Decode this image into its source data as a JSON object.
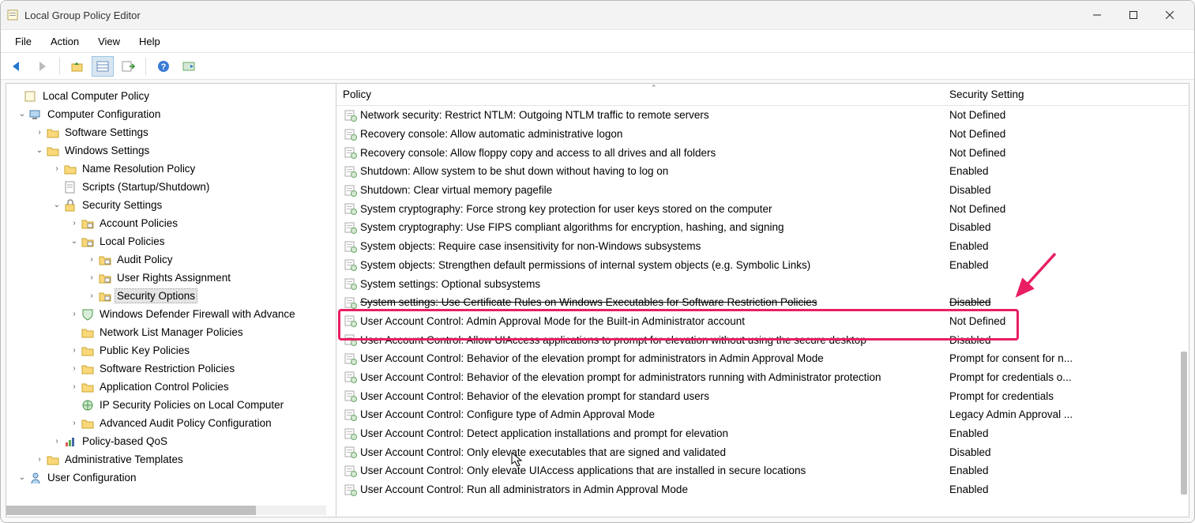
{
  "window": {
    "title": "Local Group Policy Editor"
  },
  "menubar": [
    "File",
    "Action",
    "View",
    "Help"
  ],
  "tree": {
    "root": "Local Computer Policy",
    "cc": "Computer Configuration",
    "ss": "Software Settings",
    "ws": "Windows Settings",
    "nrp": "Name Resolution Policy",
    "scripts": "Scripts (Startup/Shutdown)",
    "sec": "Security Settings",
    "ap": "Account Policies",
    "lp": "Local Policies",
    "audit": "Audit Policy",
    "ura": "User Rights Assignment",
    "so": "Security Options",
    "wdf": "Windows Defender Firewall with Advance",
    "nlmp": "Network List Manager Policies",
    "pkp": "Public Key Policies",
    "srp": "Software Restriction Policies",
    "acp": "Application Control Policies",
    "ipsec": "IP Security Policies on Local Computer",
    "aapc": "Advanced Audit Policy Configuration",
    "pbq": "Policy-based QoS",
    "at": "Administrative Templates",
    "uc": "User Configuration"
  },
  "list": {
    "columns": {
      "policy": "Policy",
      "setting": "Security Setting"
    },
    "rows": [
      {
        "policy": "Network security: Restrict NTLM: Outgoing NTLM traffic to remote servers",
        "setting": "Not Defined"
      },
      {
        "policy": "Recovery console: Allow automatic administrative logon",
        "setting": "Not Defined"
      },
      {
        "policy": "Recovery console: Allow floppy copy and access to all drives and all folders",
        "setting": "Not Defined"
      },
      {
        "policy": "Shutdown: Allow system to be shut down without having to log on",
        "setting": "Enabled"
      },
      {
        "policy": "Shutdown: Clear virtual memory pagefile",
        "setting": "Disabled"
      },
      {
        "policy": "System cryptography: Force strong key protection for user keys stored on the computer",
        "setting": "Not Defined"
      },
      {
        "policy": "System cryptography: Use FIPS compliant algorithms for encryption, hashing, and signing",
        "setting": "Disabled"
      },
      {
        "policy": "System objects: Require case insensitivity for non-Windows subsystems",
        "setting": "Enabled"
      },
      {
        "policy": "System objects: Strengthen default permissions of internal system objects (e.g. Symbolic Links)",
        "setting": "Enabled"
      },
      {
        "policy": "System settings: Optional subsystems",
        "setting": ""
      },
      {
        "policy": "System settings: Use Certificate Rules on Windows Executables for Software Restriction Policies",
        "setting": "Disabled",
        "struck": true
      },
      {
        "policy": "User Account Control: Admin Approval Mode for the Built-in Administrator account",
        "setting": "Not Defined",
        "highlighted": true
      },
      {
        "policy": "User Account Control: Allow UIAccess applications to prompt for elevation without using the secure desktop",
        "setting": "Disabled",
        "struck": true
      },
      {
        "policy": "User Account Control: Behavior of the elevation prompt for administrators in Admin Approval Mode",
        "setting": "Prompt for consent for n..."
      },
      {
        "policy": "User Account Control: Behavior of the elevation prompt for administrators running with Administrator protection",
        "setting": "Prompt for credentials o..."
      },
      {
        "policy": "User Account Control: Behavior of the elevation prompt for standard users",
        "setting": "Prompt for credentials"
      },
      {
        "policy": "User Account Control: Configure type of Admin Approval Mode",
        "setting": "Legacy Admin Approval ..."
      },
      {
        "policy": "User Account Control: Detect application installations and prompt for elevation",
        "setting": "Enabled"
      },
      {
        "policy": "User Account Control: Only elevate executables that are signed and validated",
        "setting": "Disabled"
      },
      {
        "policy": "User Account Control: Only elevate UIAccess applications that are installed in secure locations",
        "setting": "Enabled"
      },
      {
        "policy": "User Account Control: Run all administrators in Admin Approval Mode",
        "setting": "Enabled"
      }
    ]
  }
}
